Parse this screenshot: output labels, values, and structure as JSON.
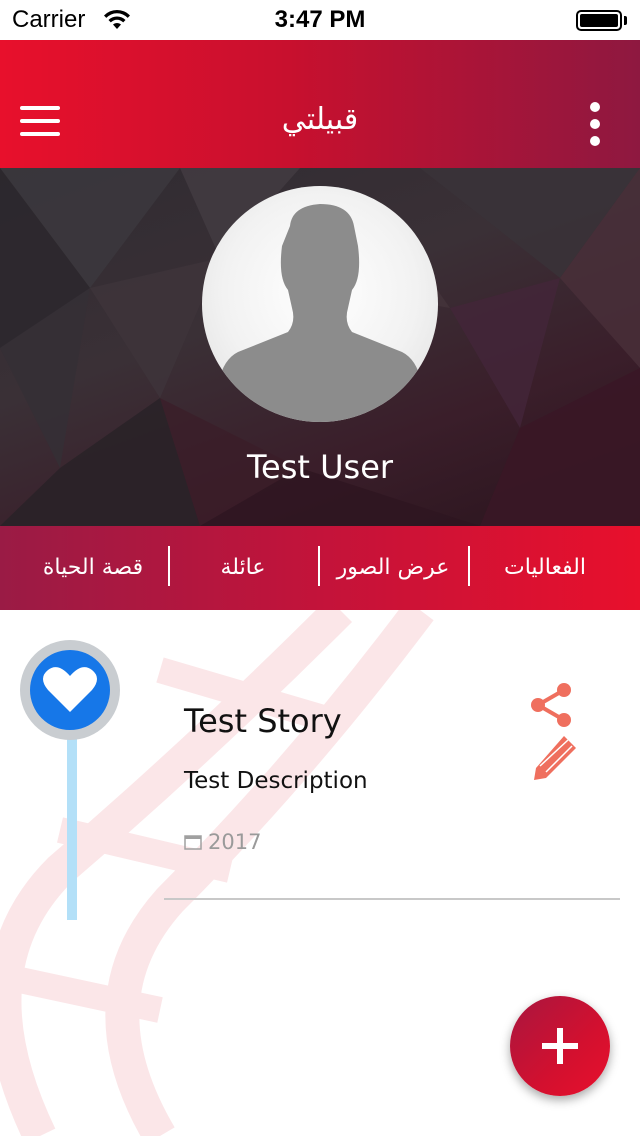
{
  "status_bar": {
    "carrier": "Carrier",
    "time": "3:47 PM"
  },
  "app_bar": {
    "title": "قبيلتي",
    "menu_icon": "hamburger-menu-icon",
    "more_icon": "more-vertical-icon"
  },
  "profile": {
    "user_name": "Test User",
    "avatar_icon": "person-silhouette-icon"
  },
  "tabs": [
    {
      "label": "الفعاليات"
    },
    {
      "label": "عرض الصور"
    },
    {
      "label": "عائلة"
    },
    {
      "label": "قصة الحياة"
    }
  ],
  "story": {
    "title": "Test Story",
    "description": "Test Description",
    "year": "2017",
    "node_icon": "heart-icon",
    "share_icon": "share-icon",
    "edit_icon": "pencil-icon",
    "calendar_icon": "calendar-icon"
  },
  "fab": {
    "icon": "plus-icon"
  },
  "colors": {
    "primary_red": "#e8102c",
    "primary_dark": "#8e1840",
    "node_blue": "#1677e8",
    "timeline_line": "#b3e0f8",
    "action_coral": "#ef6f5e"
  }
}
